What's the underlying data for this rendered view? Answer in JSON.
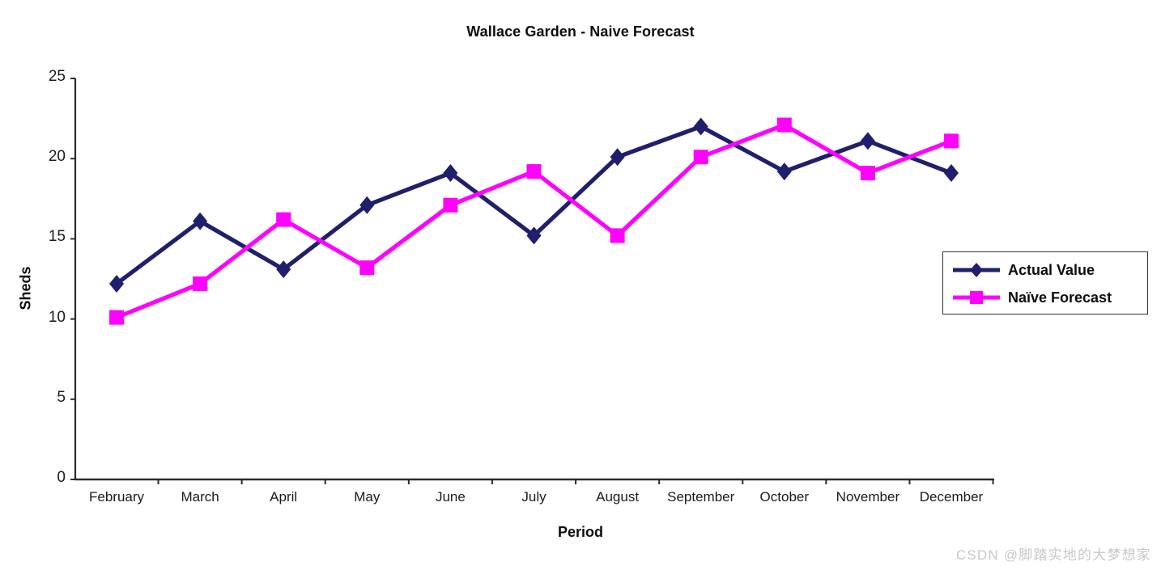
{
  "watermark": "CSDN @脚踏实地的大梦想家",
  "legend": {
    "entries": [
      {
        "label": "Actual Value",
        "color": "#1F1F6E",
        "marker": "diamond"
      },
      {
        "label": "Naïve Forecast",
        "color": "#FF00FF",
        "marker": "square"
      }
    ]
  },
  "chart_data": {
    "type": "line",
    "title": "Wallace Garden - Naive Forecast",
    "xlabel": "Period",
    "ylabel": "Sheds",
    "categories": [
      "February",
      "March",
      "April",
      "May",
      "June",
      "July",
      "August",
      "September",
      "October",
      "November",
      "December"
    ],
    "ylim": [
      0,
      25
    ],
    "yticks": [
      0,
      5,
      10,
      15,
      20,
      25
    ],
    "ytick_labels": [
      "0",
      "5",
      "10",
      "15",
      "20",
      "25"
    ],
    "grid": false,
    "legend_position": "right",
    "series": [
      {
        "name": "Actual Value",
        "color": "#1F1F6E",
        "marker": "diamond",
        "values": [
          12.2,
          16.1,
          13.1,
          17.1,
          19.1,
          15.2,
          20.1,
          22.0,
          19.2,
          21.1,
          19.1
        ]
      },
      {
        "name": "Naïve Forecast",
        "color": "#FF00FF",
        "marker": "square",
        "values": [
          10.1,
          12.2,
          16.2,
          13.2,
          17.1,
          19.2,
          15.2,
          20.1,
          22.1,
          19.1,
          21.1
        ]
      }
    ]
  }
}
